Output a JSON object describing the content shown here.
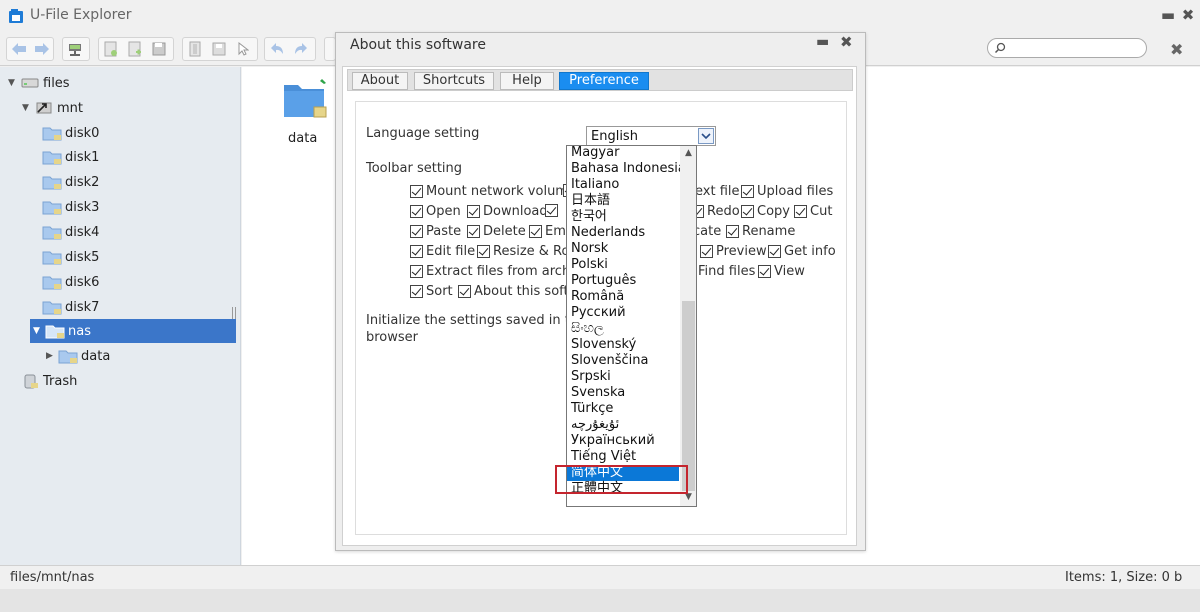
{
  "app": {
    "title": "U-File Explorer",
    "minimize": "▬",
    "close": "✖"
  },
  "search": {
    "placeholder": "",
    "clear": "✖"
  },
  "tree": {
    "root": "files",
    "mnt": "mnt",
    "disks": [
      "disk0",
      "disk1",
      "disk2",
      "disk3",
      "disk4",
      "disk5",
      "disk6",
      "disk7"
    ],
    "nas": "nas",
    "nas_child": "data",
    "trash": "Trash"
  },
  "main": {
    "folder_label": "data"
  },
  "status": {
    "path": "files/mnt/nas",
    "info": "Items: 1, Size: 0 b"
  },
  "dialog": {
    "title": "About this software",
    "minimize": "▬",
    "close": "✖",
    "tabs": [
      "About",
      "Shortcuts",
      "Help",
      "Preference"
    ],
    "language_label": "Language setting",
    "language_value": "English",
    "toolbar_label": "Toolbar setting",
    "toolbar_options": [
      "Mount network volume",
      "ext file",
      "Upload files",
      "Open",
      "Download",
      "Redo",
      "Copy",
      "Cut",
      "Paste",
      "Delete",
      "Em",
      "cate",
      "Rename",
      "Edit file",
      "Resize & Ro",
      "Preview",
      "Get info",
      "Extract files from archive",
      "Find files",
      "View",
      "Sort",
      "About this softw"
    ],
    "init_label_1": "Initialize the settings saved in this",
    "init_label_2": "browser"
  },
  "languages": [
    "Magyar",
    "Bahasa Indonesia",
    "Italiano",
    "日本語",
    "한국어",
    "Nederlands",
    "Norsk",
    "Polski",
    "Português",
    "Română",
    "Русский",
    "සිංහල",
    "Slovenský",
    "Slovenščina",
    "Srpski",
    "Svenska",
    "Türkçe",
    "ئۇيغۇرچە",
    "Український",
    "Tiếng Việt",
    "简体中文",
    "正體中文"
  ],
  "selected_language": "简体中文",
  "colors": {
    "selection": "#3b76c9",
    "active_tab": "#1a8df0",
    "highlight": "#0b78d7",
    "annotation": "#c4252e"
  }
}
